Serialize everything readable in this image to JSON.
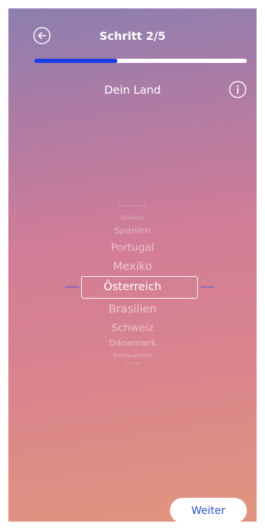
{
  "header": {
    "step_label": "Schritt 2/5",
    "back_icon": "arrow-left-circle-icon"
  },
  "progress": {
    "value": 0.39
  },
  "section": {
    "title": "Dein Land",
    "info_icon": "info-circle-icon"
  },
  "picker": {
    "items_above": [
      "Frankreich",
      "Italien",
      "Spanien",
      "Portugal",
      "Mexiko"
    ],
    "selected": "Österreich",
    "items_below": [
      "Brasilien",
      "Schweiz",
      "Dänemark",
      "Schweden",
      "Israel"
    ]
  },
  "footer": {
    "next_label": "Weiter"
  },
  "colors": {
    "progress_fill": "#1a3ce6",
    "button_text": "#2b50e8",
    "selection_line": "#3d55e0"
  }
}
